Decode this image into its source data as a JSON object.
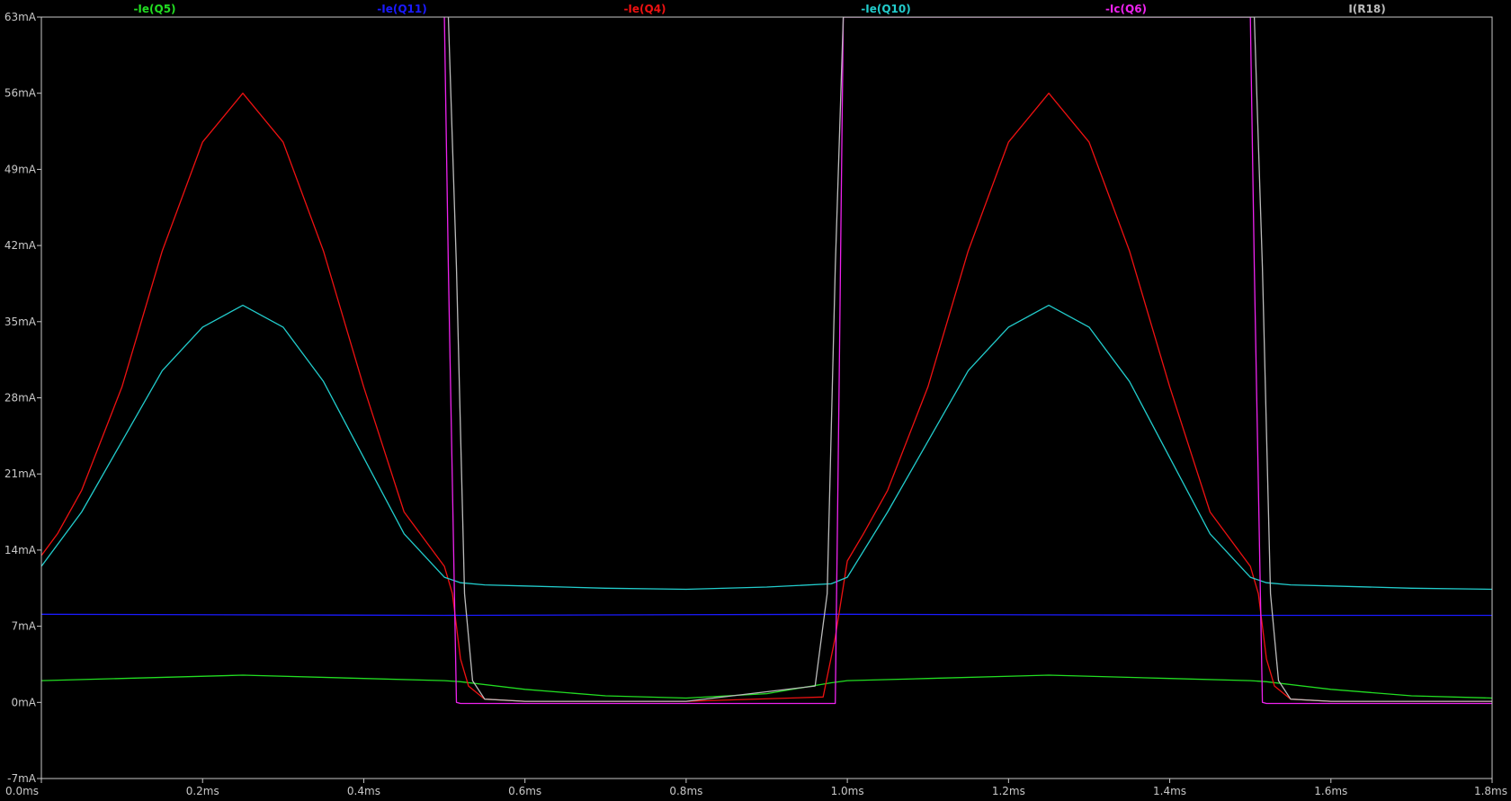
{
  "chart_data": {
    "type": "line",
    "title": "",
    "xlabel": "",
    "ylabel": "",
    "xlim": [
      0,
      1.8
    ],
    "ylim": [
      -7,
      63
    ],
    "grid": false,
    "legend_position": "top",
    "x_ticks": [
      0.0,
      0.2,
      0.4,
      0.6,
      0.8,
      1.0,
      1.2,
      1.4,
      1.6,
      1.8
    ],
    "x_tick_labels": [
      "0.0ms",
      "0.2ms",
      "0.4ms",
      "0.6ms",
      "0.8ms",
      "1.0ms",
      "1.2ms",
      "1.4ms",
      "1.6ms",
      "1.8ms"
    ],
    "y_ticks": [
      -7,
      0,
      7,
      14,
      21,
      28,
      35,
      42,
      49,
      56,
      63
    ],
    "y_tick_labels": [
      "-7mA",
      "0mA",
      "7mA",
      "14mA",
      "21mA",
      "28mA",
      "35mA",
      "42mA",
      "49mA",
      "56mA",
      "63mA"
    ],
    "background": "#000000",
    "axis_color": "#c8c8c8",
    "series": [
      {
        "name": "-Ie(Q5)",
        "color": "#22dd22",
        "x": [
          0.0,
          0.1,
          0.25,
          0.4,
          0.5,
          0.52,
          0.6,
          0.7,
          0.8,
          0.9,
          0.98,
          1.0,
          1.1,
          1.25,
          1.4,
          1.5,
          1.52,
          1.6,
          1.7,
          1.8
        ],
        "y": [
          2.0,
          2.2,
          2.5,
          2.2,
          2.0,
          1.9,
          1.2,
          0.6,
          0.4,
          0.8,
          1.8,
          2.0,
          2.2,
          2.5,
          2.2,
          2.0,
          1.9,
          1.2,
          0.6,
          0.4
        ]
      },
      {
        "name": "-Ie(Q11)",
        "color": "#1a1aff",
        "x": [
          0.0,
          0.5,
          1.0,
          1.5,
          1.8
        ],
        "y": [
          8.1,
          8.0,
          8.1,
          8.0,
          8.0
        ]
      },
      {
        "name": "-Ie(Q4)",
        "color": "#ee1111",
        "x": [
          0.0,
          0.02,
          0.05,
          0.1,
          0.15,
          0.2,
          0.25,
          0.3,
          0.35,
          0.4,
          0.45,
          0.5,
          0.51,
          0.52,
          0.53,
          0.55,
          0.6,
          0.8,
          0.97,
          0.985,
          1.0,
          1.02,
          1.05,
          1.1,
          1.15,
          1.2,
          1.25,
          1.3,
          1.35,
          1.4,
          1.45,
          1.5,
          1.51,
          1.52,
          1.53,
          1.55,
          1.6,
          1.8
        ],
        "y": [
          13.5,
          15.5,
          19.5,
          29.0,
          41.5,
          51.5,
          56.0,
          51.5,
          41.5,
          29.0,
          17.5,
          12.5,
          10.0,
          4.0,
          1.5,
          0.3,
          0.1,
          0.1,
          0.5,
          6.0,
          13.0,
          15.5,
          19.5,
          29.0,
          41.5,
          51.5,
          56.0,
          51.5,
          41.5,
          29.0,
          17.5,
          12.5,
          10.0,
          4.0,
          1.5,
          0.3,
          0.1,
          0.1
        ]
      },
      {
        "name": "-Ie(Q10)",
        "color": "#22cccc",
        "x": [
          0.0,
          0.05,
          0.1,
          0.15,
          0.2,
          0.25,
          0.3,
          0.35,
          0.4,
          0.45,
          0.5,
          0.52,
          0.55,
          0.6,
          0.7,
          0.8,
          0.9,
          0.98,
          1.0,
          1.05,
          1.1,
          1.15,
          1.2,
          1.25,
          1.3,
          1.35,
          1.4,
          1.45,
          1.5,
          1.52,
          1.55,
          1.6,
          1.7,
          1.8
        ],
        "y": [
          12.5,
          17.5,
          24.0,
          30.5,
          34.5,
          36.5,
          34.5,
          29.5,
          22.5,
          15.5,
          11.5,
          11.0,
          10.8,
          10.7,
          10.5,
          10.4,
          10.6,
          10.9,
          11.5,
          17.5,
          24.0,
          30.5,
          34.5,
          36.5,
          34.5,
          29.5,
          22.5,
          15.5,
          11.5,
          11.0,
          10.8,
          10.7,
          10.5,
          10.4
        ]
      },
      {
        "name": "-Ic(Q6)",
        "color": "#ee22ee",
        "x": [
          0.5,
          0.505,
          0.515,
          0.52,
          0.6,
          0.8,
          0.985,
          0.99,
          0.995,
          1.5,
          1.505,
          1.515,
          1.52,
          1.6,
          1.8
        ],
        "y": [
          63,
          40,
          0,
          -0.1,
          -0.1,
          -0.1,
          -0.1,
          30,
          63,
          63,
          40,
          0,
          -0.1,
          -0.1,
          -0.1
        ]
      },
      {
        "name": "I(R18)",
        "color": "#bbbbbb",
        "x": [
          0.505,
          0.515,
          0.525,
          0.535,
          0.55,
          0.6,
          0.8,
          0.96,
          0.975,
          0.985,
          0.995,
          1.505,
          1.515,
          1.525,
          1.535,
          1.55,
          1.6,
          1.8
        ],
        "y": [
          63,
          40,
          10,
          2,
          0.3,
          0.1,
          0.1,
          1.5,
          10,
          40,
          63,
          63,
          40,
          10,
          2,
          0.3,
          0.1,
          0.1
        ]
      }
    ]
  }
}
